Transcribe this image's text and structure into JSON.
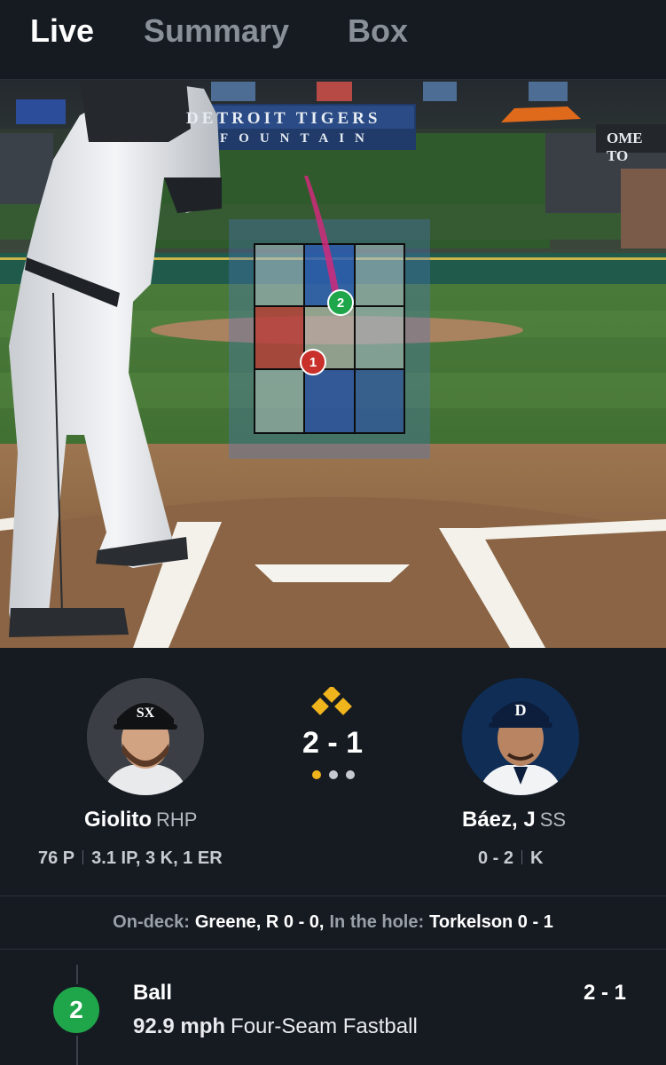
{
  "tabs": [
    {
      "label": "Live",
      "active": true
    },
    {
      "label": "Summary",
      "active": false
    },
    {
      "label": "Box",
      "active": false
    }
  ],
  "field": {
    "banner_title": "DETROIT TIGERS",
    "banner_subtitle": "FOUNTAIN",
    "banner_right": "OME TO",
    "pitches": [
      {
        "number": "1",
        "color": "#c9302b"
      },
      {
        "number": "2",
        "color": "#1fa64a"
      }
    ]
  },
  "matchup": {
    "pitcher": {
      "name": "Giolito",
      "position": "RHP",
      "pitches": "76 P",
      "line": "3.1 IP, 3 K, 1 ER"
    },
    "batter": {
      "name": "Báez, J",
      "position": "SS",
      "record": "0 - 2",
      "result": "K"
    },
    "count": "2 - 1",
    "bases_color": "#f0b41c",
    "outs": [
      true,
      false,
      false
    ]
  },
  "ondeck": {
    "ondeck_label": "On-deck:",
    "ondeck_player": "Greene, R 0 - 0,",
    "hole_label": "In the hole:",
    "hole_player": "Torkelson 0 - 1"
  },
  "log": {
    "pitch_number": "2",
    "result": "Ball",
    "count": "2 - 1",
    "speed": "92.9 mph",
    "pitch_type": "Four-Seam Fastball"
  }
}
